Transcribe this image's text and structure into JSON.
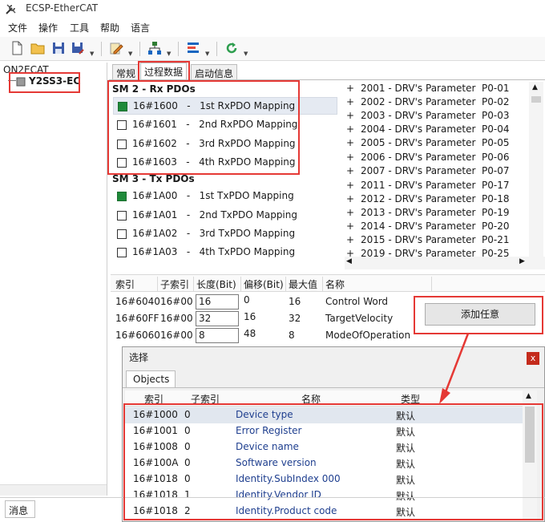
{
  "window": {
    "title": "ECSP-EtherCAT"
  },
  "menu": [
    "文件",
    "操作",
    "工具",
    "帮助",
    "语言"
  ],
  "tree": {
    "root": "ON2ECAT",
    "child": "Y2SS3-EC"
  },
  "tabs": [
    "常规",
    "过程数据",
    "启动信息"
  ],
  "sm2": {
    "title": "SM 2 - Rx PDOs",
    "items": [
      {
        "text": "16#1600   -   1st RxPDO Mapping",
        "checked": true
      },
      {
        "text": "16#1601   -   2nd RxPDO Mapping",
        "checked": false
      },
      {
        "text": "16#1602   -   3rd RxPDO Mapping",
        "checked": false
      },
      {
        "text": "16#1603   -   4th RxPDO Mapping",
        "checked": false
      }
    ]
  },
  "sm3": {
    "title": "SM 3 - Tx PDOs",
    "items": [
      {
        "text": "16#1A00   -   1st TxPDO Mapping",
        "checked": true
      },
      {
        "text": "16#1A01   -   2nd TxPDO Mapping",
        "checked": false
      },
      {
        "text": "16#1A02   -   3rd TxPDO Mapping",
        "checked": false
      },
      {
        "text": "16#1A03   -   4th TxPDO Mapping",
        "checked": false
      }
    ]
  },
  "params": [
    "2001 - DRV's Parameter  P0-01",
    "2002 - DRV's Parameter  P0-02",
    "2003 - DRV's Parameter  P0-03",
    "2004 - DRV's Parameter  P0-04",
    "2005 - DRV's Parameter  P0-05",
    "2006 - DRV's Parameter  P0-06",
    "2007 - DRV's Parameter  P0-07",
    "2011 - DRV's Parameter  P0-17",
    "2012 - DRV's Parameter  P0-18",
    "2013 - DRV's Parameter  P0-19",
    "2014 - DRV's Parameter  P0-20",
    "2015 - DRV's Parameter  P0-21",
    "2019 - DRV's Parameter  P0-25"
  ],
  "param_plus": "+",
  "mapping": {
    "headers": [
      "索引",
      "子索引",
      "长度(Bit)",
      "偏移(Bit)",
      "最大值",
      "名称"
    ],
    "rows": [
      {
        "index": "16#6040",
        "sub": "16#00",
        "len": "16",
        "offset": "0",
        "max": "16",
        "name": "Control Word"
      },
      {
        "index": "16#60FF",
        "sub": "16#00",
        "len": "32",
        "offset": "16",
        "max": "32",
        "name": "TargetVelocity"
      },
      {
        "index": "16#6060",
        "sub": "16#00",
        "len": "8",
        "offset": "48",
        "max": "8",
        "name": "ModeOfOperation"
      }
    ]
  },
  "add_button": "添加任意",
  "dialog": {
    "title": "选择",
    "close": "x",
    "tab": "Objects",
    "headers": [
      "索引",
      "子索引",
      "名称",
      "类型"
    ],
    "rows": [
      {
        "index": "16#1000",
        "sub": "0",
        "name": "Device type",
        "type": "默认"
      },
      {
        "index": "16#1001",
        "sub": "0",
        "name": "Error Register",
        "type": "默认"
      },
      {
        "index": "16#1008",
        "sub": "0",
        "name": "Device name",
        "type": "默认"
      },
      {
        "index": "16#100A",
        "sub": "0",
        "name": "Software version",
        "type": "默认"
      },
      {
        "index": "16#1018",
        "sub": "0",
        "name": "Identity.SubIndex 000",
        "type": "默认"
      },
      {
        "index": "16#1018",
        "sub": "1",
        "name": "Identity.Vendor ID",
        "type": "默认"
      },
      {
        "index": "16#1018",
        "sub": "2",
        "name": "Identity.Product code",
        "type": "默认"
      }
    ]
  },
  "status_tab": "消息",
  "colors": {
    "annotation_red": "#e53935",
    "checked_green": "#1f8a3a",
    "dialog_text_blue": "#1f3f8f"
  },
  "icons": [
    "tools-icon",
    "new-file-icon",
    "open-folder-icon",
    "save-icon",
    "save-as-icon",
    "edit-icon",
    "network-scan-icon",
    "config-list-icon",
    "refresh-icon"
  ]
}
